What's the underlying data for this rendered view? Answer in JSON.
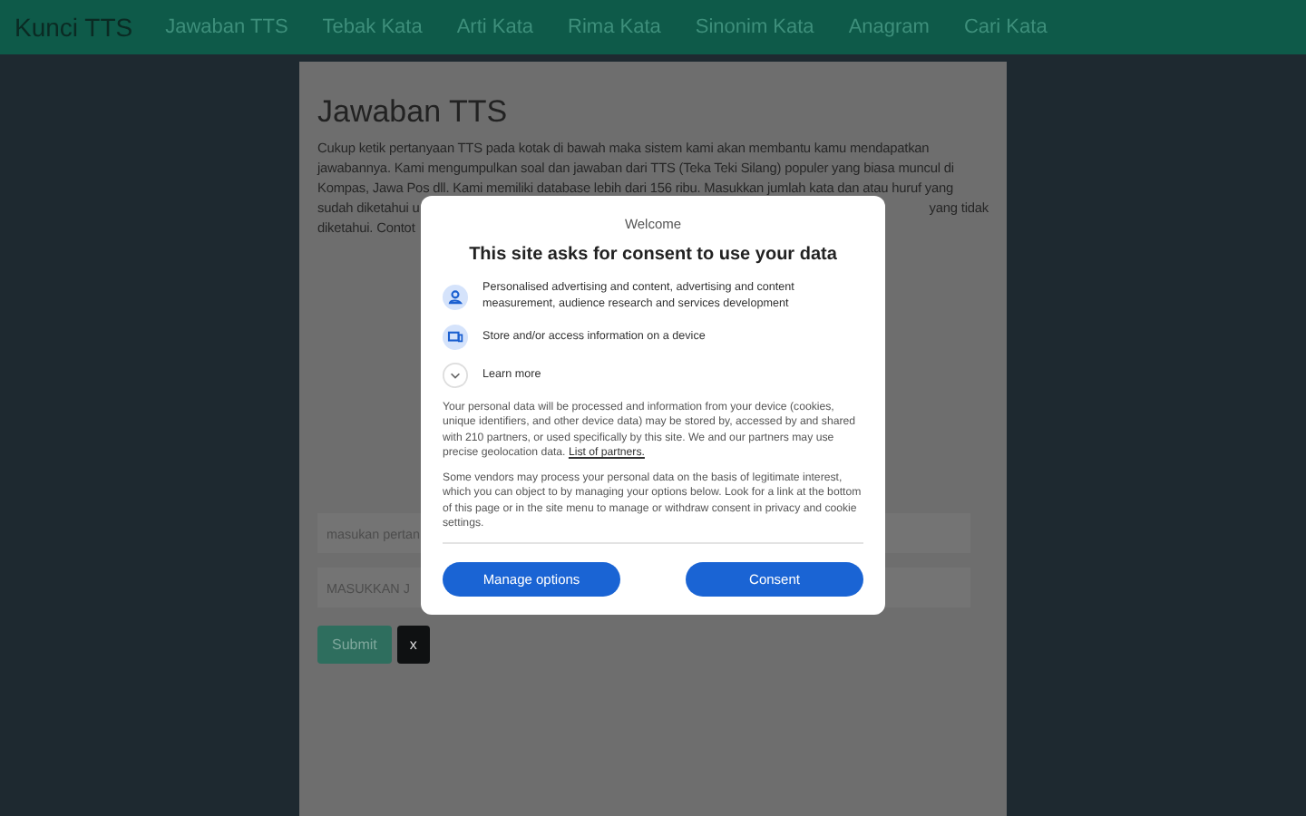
{
  "navbar": {
    "brand": "Kunci TTS",
    "links": [
      "Jawaban TTS",
      "Tebak Kata",
      "Arti Kata",
      "Rima Kata",
      "Sinonim Kata",
      "Anagram",
      "Cari Kata"
    ]
  },
  "content": {
    "title": "Jawaban TTS",
    "paragraph_lines": [
      "Cukup ketik pertanyaan TTS pada kotak di bawah maka sistem kami akan membantu kamu mendapatkan",
      "jawabannya. Kami mengumpulkan soal dan jawaban dari TTS (Teka Teki Silang) populer yang biasa muncul di",
      "Kompas, Jawa Pos dll. Kami memiliki database lebih dari 156 ribu. Masukkan jumlah kata dan atau huruf yang"
    ],
    "line_4_left": "sudah diketahui u",
    "line_4_right": "yang tidak",
    "line_5": "diketahui. Contot",
    "fields": [
      {
        "placeholder": "masukan pertan"
      },
      {
        "placeholder": "MASUKKAN J"
      }
    ],
    "buttons": [
      {
        "label": "Submit",
        "kind": "primary"
      },
      {
        "label": "x",
        "kind": "dark"
      }
    ]
  },
  "dialog": {
    "header": "Welcome",
    "title": "This site asks for consent to use your data",
    "purposes": [
      {
        "kind": "person",
        "text": "Personalised advertising and content, advertising and content measurement, audience research and services development"
      },
      {
        "kind": "device",
        "text": "Store and/or access information on a device"
      },
      {
        "kind": "expand",
        "text": "Learn more"
      }
    ],
    "paragraph_1": "Your personal data will be processed and information from your device (cookies, unique identifiers, and other device data) may be stored by, accessed by and shared with 210 partners, or used specifically by this site. We and our partners may use precise geolocation data.",
    "link": "List of partners.",
    "paragraph_2": "Some vendors may process your personal data on the basis of legitimate interest, which you can object to by managing your options below. Look for a link at the bottom of this page or in the site menu to manage or withdraw consent in privacy and cookie settings.",
    "buttons": [
      "Manage options",
      "Consent"
    ]
  }
}
